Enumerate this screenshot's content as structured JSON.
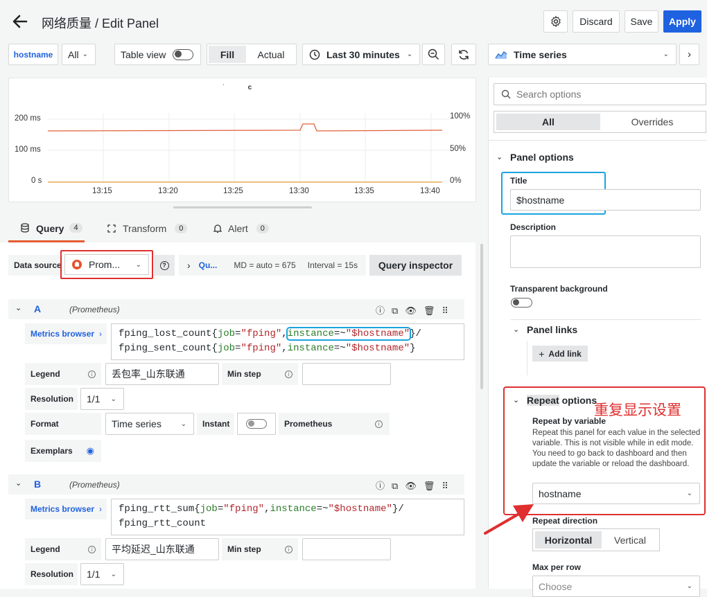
{
  "header": {
    "title": "网络质量 / Edit Panel",
    "discard_label": "Discard",
    "save_label": "Save",
    "apply_label": "Apply"
  },
  "toolbar": {
    "variable_name": "hostname",
    "variable_value": "All",
    "table_view_label": "Table view",
    "fill_label": "Fill",
    "actual_label": "Actual",
    "time_range": "Last 30 minutes",
    "visualization": "Time series"
  },
  "chart_data": {
    "type": "line",
    "title": "",
    "x": [
      "13:15",
      "13:20",
      "13:25",
      "13:30",
      "13:35",
      "13:40"
    ],
    "y_left_ticks": [
      "0 s",
      "100 ms",
      "200 ms"
    ],
    "y_right_ticks": [
      "0%",
      "50%",
      "100%"
    ],
    "series": [
      {
        "color": "#e0603a",
        "description_level_ms": 188,
        "spike_ms": 208
      },
      {
        "color": "#e8a23a",
        "description_level_pct": 0.5
      }
    ]
  },
  "query_tabs": [
    {
      "label": "Query",
      "count": "4"
    },
    {
      "label": "Transform",
      "count": "0"
    },
    {
      "label": "Alert",
      "count": "0"
    }
  ],
  "datasource": {
    "label": "Data source",
    "value": "Prom...",
    "query_options": "Qu...",
    "md": "MD = auto = 675",
    "interval": "Interval = 15s",
    "inspector_label": "Query inspector"
  },
  "queries": [
    {
      "letter": "A",
      "source": "(Prometheus)",
      "metrics_browser": "Metrics browser",
      "expr_line1_a": "fping_lost_count{",
      "expr_line1_b": "job",
      "expr_line1_c": "=",
      "expr_line1_d": "\"fping\"",
      "expr_line1_e": ",",
      "expr_line1_f": "instance",
      "expr_line1_g": "=~",
      "expr_line1_h": "\"$hostname\"",
      "expr_line1_i": "}/",
      "expr_line2_a": "fping_sent_count{",
      "expr_line2_b": "job",
      "expr_line2_c": "=",
      "expr_line2_d": "\"fping\"",
      "expr_line2_e": ",",
      "expr_line2_f": "instance",
      "expr_line2_g": "=~",
      "expr_line2_h": "\"$hostname\"",
      "expr_line2_i": "}",
      "legend_label": "Legend",
      "legend_value": "丢包率_山东联通",
      "min_step_label": "Min step",
      "resolution_label": "Resolution",
      "resolution_value": "1/1",
      "format_label": "Format",
      "format_value": "Time series",
      "instant_label": "Instant",
      "prometheus_label": "Prometheus",
      "exemplars_label": "Exemplars"
    },
    {
      "letter": "B",
      "source": "(Prometheus)",
      "metrics_browser": "Metrics browser",
      "expr_line1_a": "fping_rtt_sum{",
      "expr_line1_b": "job",
      "expr_line1_c": "=",
      "expr_line1_d": "\"fping\"",
      "expr_line1_e": ",",
      "expr_line1_f": "instance",
      "expr_line1_g": "=~",
      "expr_line1_h": "\"$hostname\"",
      "expr_line1_i": "}/",
      "expr_line2_a": "fping_rtt_count",
      "legend_label": "Legend",
      "legend_value": "平均延迟_山东联通",
      "min_step_label": "Min step",
      "resolution_label": "Resolution",
      "resolution_value": "1/1"
    }
  ],
  "options": {
    "search_placeholder": "Search options",
    "tab_all": "All",
    "tab_overrides": "Overrides",
    "panel_options_label": "Panel options",
    "title_label": "Title",
    "title_value": "$hostname",
    "description_label": "Description",
    "transparent_label": "Transparent background",
    "panel_links_label": "Panel links",
    "add_link_label": "Add link",
    "repeat_options_a": "Repeat",
    "repeat_options_b": " options",
    "annotation": "重复显示设置",
    "repeat_by_label": "Repeat by variable",
    "repeat_help": "Repeat this panel for each value in the selected variable. This is not visible while in edit mode. You need to go back to dashboard and then update the variable or reload the dashboard.",
    "repeat_value": "hostname",
    "repeat_direction_label": "Repeat direction",
    "horizontal_label": "Horizontal",
    "vertical_label": "Vertical",
    "max_per_row_label": "Max per row",
    "max_per_row_placeholder": "Choose"
  },
  "colors": {
    "primary": "#1f62e0",
    "annotation_red": "#e02f2f",
    "highlight_blue": "#1aa3e0"
  }
}
